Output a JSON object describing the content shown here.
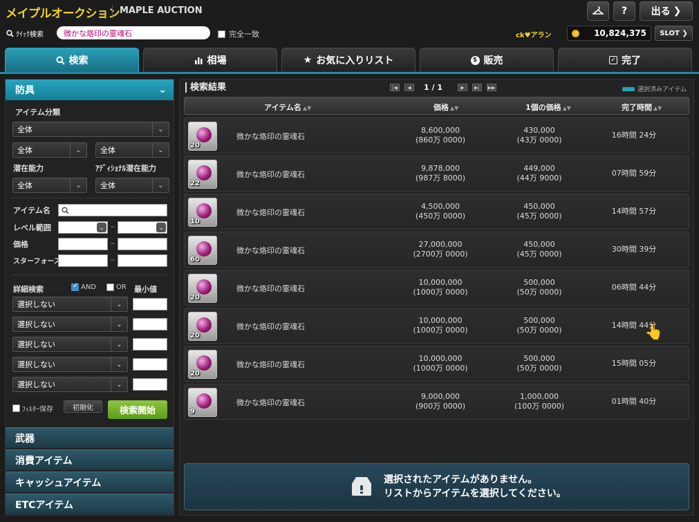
{
  "header": {
    "title": "メイプルオークション",
    "subtitle": "MAPLE AUCTION",
    "exit_label": "出る",
    "help_label": "?"
  },
  "quick_search": {
    "label": "ｸｲｯｸ検索",
    "value": "微かな烙印の霊魂石",
    "exact_match_label": "完全一致"
  },
  "user": {
    "name": "ck♥アラン",
    "meso": "10,824,375",
    "slot_label": "SLOT"
  },
  "tabs": [
    {
      "label": "検索",
      "icon": "search-icon"
    },
    {
      "label": "相場",
      "icon": "bar-chart-icon"
    },
    {
      "label": "お気に入りリスト",
      "icon": "star-icon"
    },
    {
      "label": "販売",
      "icon": "coin-icon"
    },
    {
      "label": "完了",
      "icon": "check-icon"
    }
  ],
  "sidebar": {
    "category_header": "防具",
    "item_class_label": "アイテム分類",
    "item_class_value": "全体",
    "sub_class_1": "全体",
    "sub_class_2": "全体",
    "potential_label": "潜在能力",
    "additional_potential_label": "ｱﾃﾞｨｼｮﾅﾙ潜在能力",
    "potential_value": "全体",
    "additional_potential_value": "全体",
    "item_name_label": "アイテム名",
    "level_range_label": "レベル範囲",
    "price_label": "価格",
    "starforce_label": "スターフォース",
    "detail_search_label": "詳細検索",
    "and_label": "AND",
    "or_label": "OR",
    "min_value_label": "最小値",
    "detail_filters": [
      "選択しない",
      "選択しない",
      "選択しない",
      "選択しない",
      "選択しない"
    ],
    "save_filter_label": "ﾌｨﾙﾀｰ保存",
    "reset_label": "初期化",
    "search_label": "検索開始",
    "categories": [
      "武器",
      "消費アイテム",
      "キャッシュアイテム",
      "ETCアイテム"
    ]
  },
  "results": {
    "title": "検索結果",
    "page": "1 / 1",
    "selected_legend": "選択済みアイテム",
    "columns": [
      "アイテム名",
      "価格",
      "1個の価格",
      "完了時間"
    ],
    "rows": [
      {
        "level": "20",
        "name": "微かな烙印の霊魂石",
        "price": "8,600,000",
        "price_man": "(860万 0000)",
        "unit": "430,000",
        "unit_man": "(43万 0000)",
        "time": "16時間 24分"
      },
      {
        "level": "22",
        "name": "微かな烙印の霊魂石",
        "price": "9,878,000",
        "price_man": "(987万 8000)",
        "unit": "449,000",
        "unit_man": "(44万 9000)",
        "time": "07時間 59分"
      },
      {
        "level": "10",
        "name": "微かな烙印の霊魂石",
        "price": "4,500,000",
        "price_man": "(450万 0000)",
        "unit": "450,000",
        "unit_man": "(45万 0000)",
        "time": "14時間 57分"
      },
      {
        "level": "60",
        "name": "微かな烙印の霊魂石",
        "price": "27,000,000",
        "price_man": "(2700万 0000)",
        "unit": "450,000",
        "unit_man": "(45万 0000)",
        "time": "30時間 39分"
      },
      {
        "level": "20",
        "name": "微かな烙印の霊魂石",
        "price": "10,000,000",
        "price_man": "(1000万 0000)",
        "unit": "500,000",
        "unit_man": "(50万 0000)",
        "time": "06時間 44分"
      },
      {
        "level": "20",
        "name": "微かな烙印の霊魂石",
        "price": "10,000,000",
        "price_man": "(1000万 0000)",
        "unit": "500,000",
        "unit_man": "(50万 0000)",
        "time": "14時間 44分"
      },
      {
        "level": "20",
        "name": "微かな烙印の霊魂石",
        "price": "10,000,000",
        "price_man": "(1000万 0000)",
        "unit": "500,000",
        "unit_man": "(50万 0000)",
        "time": "15時間 05分"
      },
      {
        "level": "9",
        "name": "微かな烙印の霊魂石",
        "price": "9,000,000",
        "price_man": "(900万 0000)",
        "unit": "1,000,000",
        "unit_man": "(100万 0000)",
        "time": "01時間 40分"
      }
    ]
  },
  "empty_selection": {
    "line1": "選択されたアイテムがありません。",
    "line2": "リストからアイテムを選択してください。"
  }
}
